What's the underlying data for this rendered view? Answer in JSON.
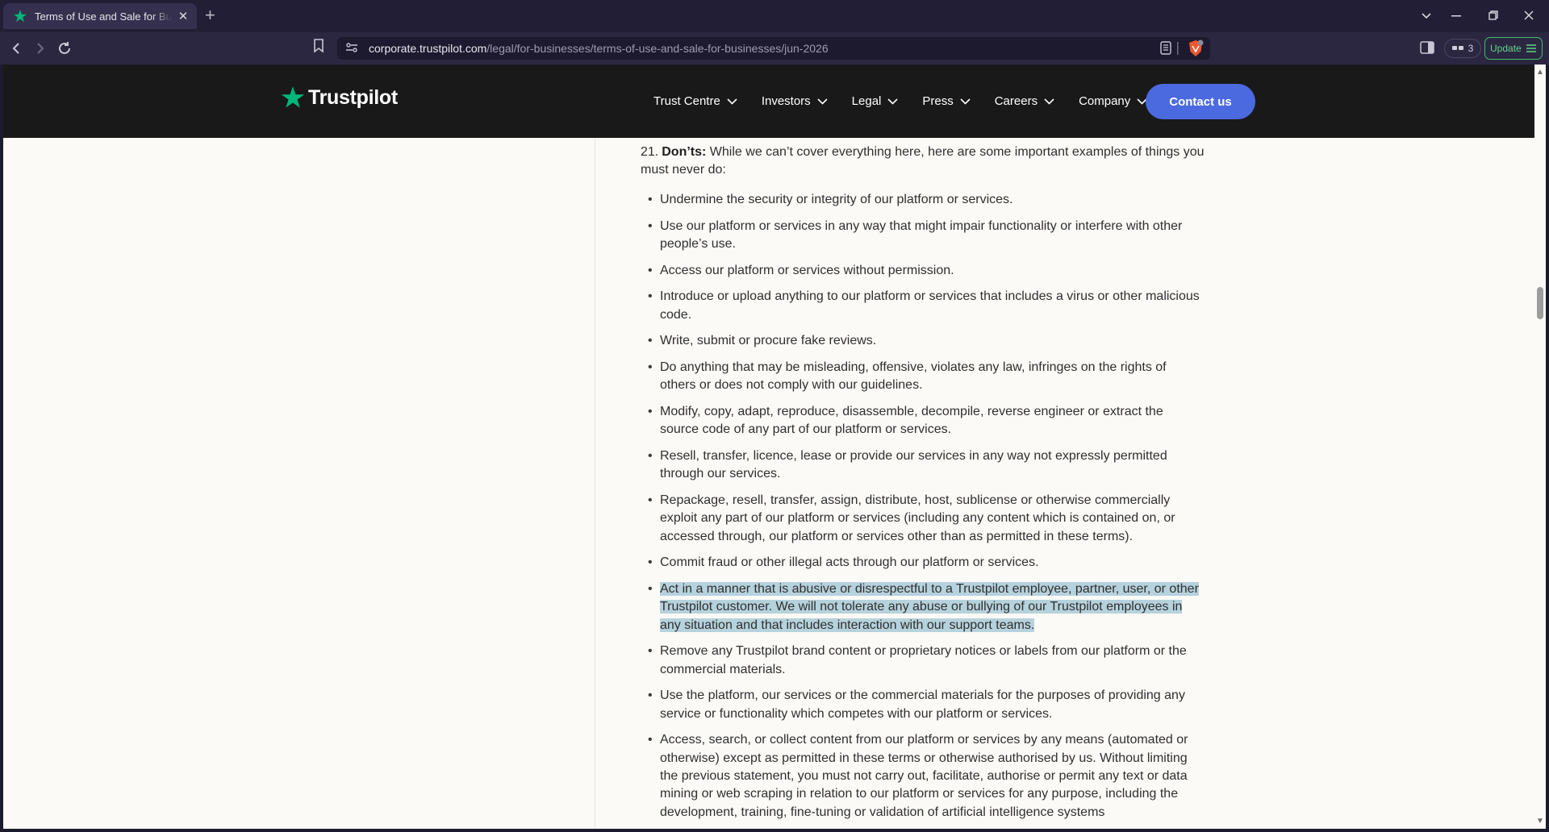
{
  "browser": {
    "tab_title": "Terms of Use and Sale for Businesses",
    "tab_close": "✕",
    "new_tab": "+",
    "url_domain": "corporate.trustpilot.com",
    "url_path": "/legal/for-businesses/terms-of-use-and-sale-for-businesses/jun-2026",
    "wallet_count": "3",
    "update_label": "Update"
  },
  "site": {
    "logo_text": "Trustpilot",
    "nav": [
      "Trust Centre",
      "Investors",
      "Legal",
      "Press",
      "Careers",
      "Company"
    ],
    "contact_label": "Contact us",
    "brand_color": "#00b67a",
    "accent_color": "#4b6ae0"
  },
  "content": {
    "intro_number": "21.",
    "intro_bold": "Don’ts:",
    "intro_text": " While we can’t cover everything here, here are some important examples of things you must never do:",
    "items": [
      "Undermine the security or integrity of our platform or services.",
      "Use our platform or services in any way that might impair functionality or interfere with other people’s use.",
      "Access our platform or services without permission.",
      "Introduce or upload anything to our platform or services that includes a virus or other malicious code.",
      "Write, submit or procure fake reviews.",
      "Do anything that may be misleading, offensive, violates any law, infringes on the rights of others or does not comply with our guidelines.",
      "Modify, copy, adapt, reproduce, disassemble, decompile, reverse engineer or extract the source code of any part of our platform or services.",
      "Resell, transfer, licence, lease or provide our services in any way not expressly permitted through our services.",
      "Repackage, resell, transfer, assign, distribute, host, sublicense or otherwise commercially exploit any part of our platform or services (including any content which is contained on, or accessed through, our platform or services other than as permitted in these terms).",
      "Commit fraud or other illegal acts through our platform or services.",
      "Act in a manner that is abusive or disrespectful to a Trustpilot employee, partner, user, or other Trustpilot customer. We will not tolerate any abuse or bullying of our Trustpilot employees in any situation and that includes interaction with our support teams.",
      "Remove any Trustpilot brand content or proprietary notices or labels from our platform or the commercial materials.",
      "Use the platform, our services or the commercial materials for the purposes of providing any service or functionality which competes with our platform or services.",
      "Access, search, or collect content from our platform or services by any means (automated or otherwise) except as permitted in these terms or otherwise authorised by us. Without limiting the previous statement, you must not carry out, facilitate, authorise or permit any text or data mining or web scraping in relation to our platform or services for any purpose, including the development, training, fine-tuning or validation of artificial intelligence systems"
    ],
    "highlighted_index": 10
  }
}
